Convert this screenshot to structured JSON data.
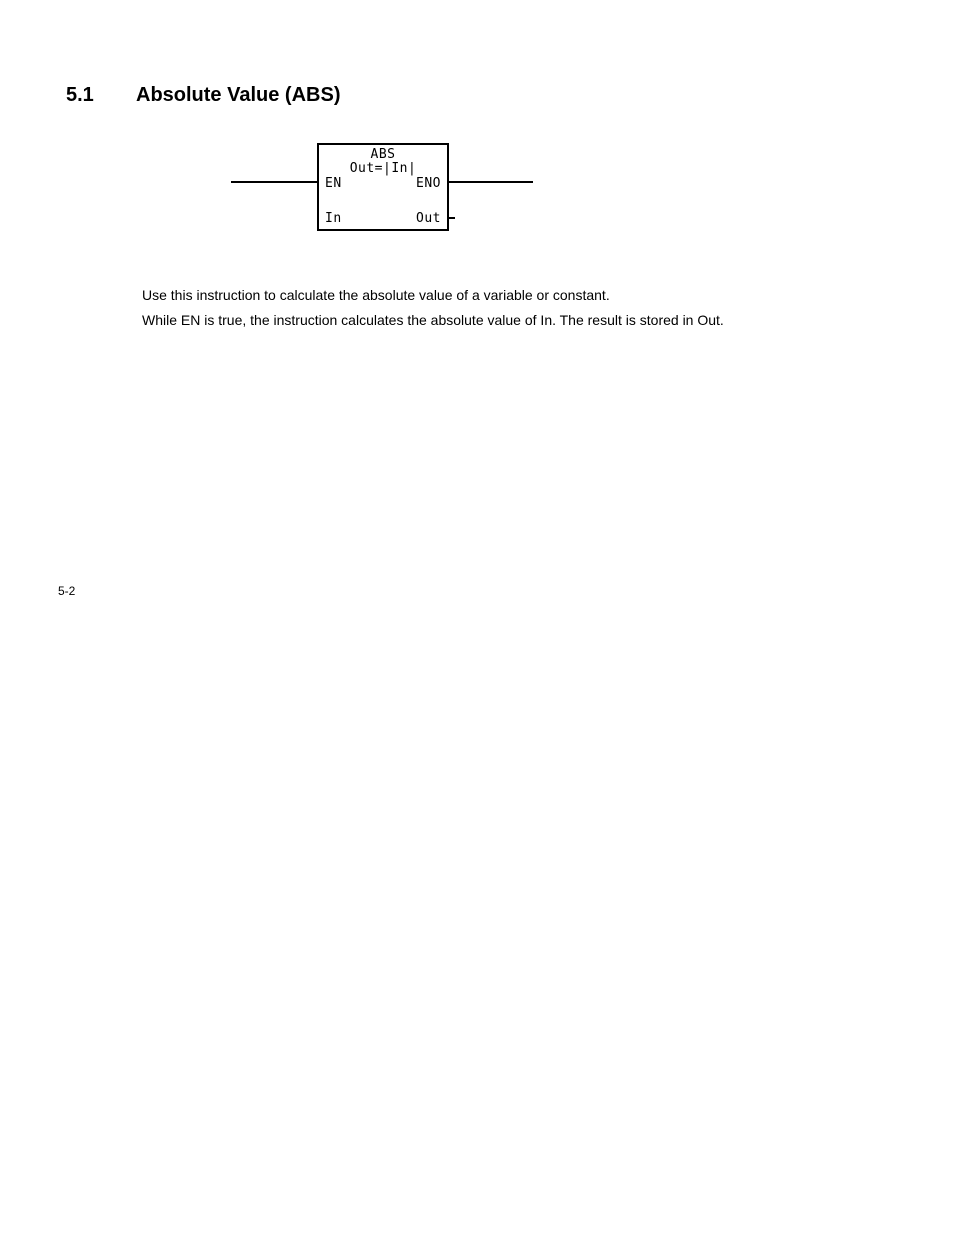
{
  "heading": {
    "number": "5.1",
    "title": "Absolute Value (ABS)"
  },
  "diagram": {
    "title1": "ABS",
    "title2": "Out=|In|",
    "en": "EN",
    "eno": "ENO",
    "in": "In",
    "out": "Out"
  },
  "paragraphs": {
    "p1": "Use this instruction to calculate the absolute value of a variable or constant.",
    "p2": "While EN is true, the instruction calculates the absolute value of In. The result is stored in Out."
  },
  "page_number": "5-2"
}
